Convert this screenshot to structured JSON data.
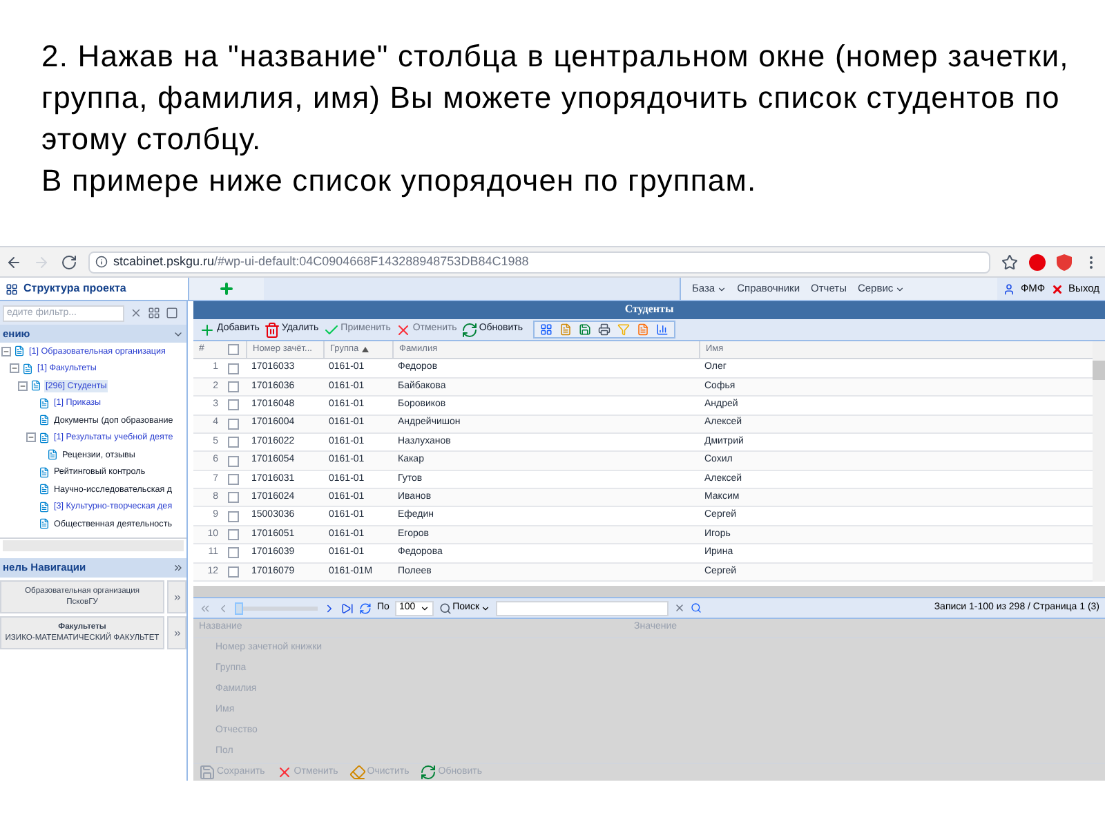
{
  "heading": {
    "paragraphs": [
      "2. Нажав на \"название\" столбца в центральном окне (номер зачетки, группа, фамилия, имя) Вы можете упорядочить список студентов по этому столбцу.",
      "В примере ниже список упорядочен по группам."
    ]
  },
  "browser": {
    "host": "stcabinet.pskgu.ru",
    "path": "/#wp-ui-default:04C0904668F143288948753DB84C1988"
  },
  "left_tab": {
    "label": "Структура проекта",
    "selected": true
  },
  "menu": [
    {
      "label": "База",
      "dropdown": true
    },
    {
      "label": "Справочники",
      "dropdown": false
    },
    {
      "label": "Отчеты",
      "dropdown": false
    },
    {
      "label": "Сервис",
      "dropdown": true
    }
  ],
  "user": {
    "name": "ФМФ",
    "logout": "Выход"
  },
  "tree_panel": {
    "filter_placeholder": "едите фильтр...",
    "title": "ению",
    "items": [
      {
        "label": "[1] Образовательная организация",
        "kind": "link",
        "selected": false,
        "expanded": true,
        "children": [
          {
            "label": "[1] Факультеты",
            "kind": "link",
            "selected": false,
            "expanded": true,
            "children": [
              {
                "label": "[296] Студенты",
                "kind": "link",
                "selected": true,
                "expanded": true,
                "children": [
                  {
                    "label": "[1] Приказы",
                    "kind": "link",
                    "selected": false
                  },
                  {
                    "label": "Документы (доп образование",
                    "kind": "plain",
                    "selected": false
                  },
                  {
                    "label": "[1] Результаты учебной деяте",
                    "kind": "link",
                    "selected": false,
                    "expanded": true,
                    "children": [
                      {
                        "label": "Рецензии, отзывы",
                        "kind": "plain",
                        "selected": false
                      }
                    ]
                  },
                  {
                    "label": "Рейтинговый контроль",
                    "kind": "plain",
                    "selected": false
                  },
                  {
                    "label": "Научно-исследовательская д",
                    "kind": "plain",
                    "selected": false
                  },
                  {
                    "label": "[3] Культурно-творческая дея",
                    "kind": "link",
                    "selected": false
                  },
                  {
                    "label": "Общественная деятельность",
                    "kind": "plain",
                    "selected": false
                  }
                ]
              }
            ]
          }
        ]
      }
    ]
  },
  "nav_panel": {
    "title": "нель Навигации",
    "buttons": [
      {
        "title": "Образовательная организация",
        "subtitle": "ПсковГУ"
      },
      {
        "title": "Факультеты",
        "subtitle": "ИЗИКО-МАТЕМАТИЧЕСКИЙ ФАКУЛЬТЕТ"
      }
    ]
  },
  "grid": {
    "title": "Студенты",
    "toolbar": [
      {
        "label": "Добавить",
        "kind": "add",
        "disabled": false
      },
      {
        "label": "Удалить",
        "kind": "delete",
        "disabled": false
      },
      {
        "label": "Применить",
        "kind": "apply",
        "disabled": true
      },
      {
        "label": "Отменить",
        "kind": "cancel",
        "disabled": true
      },
      {
        "label": "Обновить",
        "kind": "refresh",
        "disabled": false
      }
    ],
    "columns": [
      {
        "label": "Номер зачёт...",
        "sorted": false
      },
      {
        "label": "Группа",
        "sorted": true
      },
      {
        "label": "Фамилия",
        "sorted": false
      },
      {
        "label": "Имя",
        "sorted": false
      }
    ],
    "row_number_header": "#",
    "select_all_checked": false,
    "rows": [
      {
        "n": "1",
        "checked": false,
        "cells": [
          "17016033",
          "0161-01",
          "Федоров",
          "Олег"
        ]
      },
      {
        "n": "2",
        "checked": false,
        "cells": [
          "17016036",
          "0161-01",
          "Байбакова",
          "Софья"
        ]
      },
      {
        "n": "3",
        "checked": false,
        "cells": [
          "17016048",
          "0161-01",
          "Боровиков",
          "Андрей"
        ]
      },
      {
        "n": "4",
        "checked": false,
        "cells": [
          "17016004",
          "0161-01",
          "Андрейчишон",
          "Алексей"
        ]
      },
      {
        "n": "5",
        "checked": false,
        "cells": [
          "17016022",
          "0161-01",
          "Назлуханов",
          "Дмитрий"
        ]
      },
      {
        "n": "6",
        "checked": false,
        "cells": [
          "17016054",
          "0161-01",
          "Какар",
          "Сохил"
        ]
      },
      {
        "n": "7",
        "checked": false,
        "cells": [
          "17016031",
          "0161-01",
          "Гутов",
          "Алексей"
        ]
      },
      {
        "n": "8",
        "checked": false,
        "cells": [
          "17016024",
          "0161-01",
          "Иванов",
          "Максим"
        ]
      },
      {
        "n": "9",
        "checked": false,
        "cells": [
          "15003036",
          "0161-01",
          "Ефедин",
          "Сергей"
        ]
      },
      {
        "n": "10",
        "checked": false,
        "cells": [
          "17016051",
          "0161-01",
          "Егоров",
          "Игорь"
        ]
      },
      {
        "n": "11",
        "checked": false,
        "cells": [
          "17016039",
          "0161-01",
          "Федорова",
          "Ирина"
        ]
      },
      {
        "n": "12",
        "checked": false,
        "cells": [
          "17016079",
          "0161-01М",
          "Полеев",
          "Сергей"
        ]
      }
    ]
  },
  "pager": {
    "level": 0,
    "per_page_label": "По",
    "per_page": "100",
    "search_label": "Поиск",
    "summary": "Записи 1-100 из 298 / Страница 1 (3)"
  },
  "properties": {
    "disabled": true,
    "columns": [
      "Название",
      "Значение"
    ],
    "rows": [
      "Номер зачетной книжки",
      "Группа",
      "Фамилия",
      "Имя",
      "Отчество",
      "Пол"
    ],
    "buttons": [
      {
        "label": "Сохранить",
        "kind": "save"
      },
      {
        "label": "Отменить",
        "kind": "cancel"
      },
      {
        "label": "Очистить",
        "kind": "clear"
      },
      {
        "label": "Обновить",
        "kind": "refresh"
      }
    ]
  }
}
